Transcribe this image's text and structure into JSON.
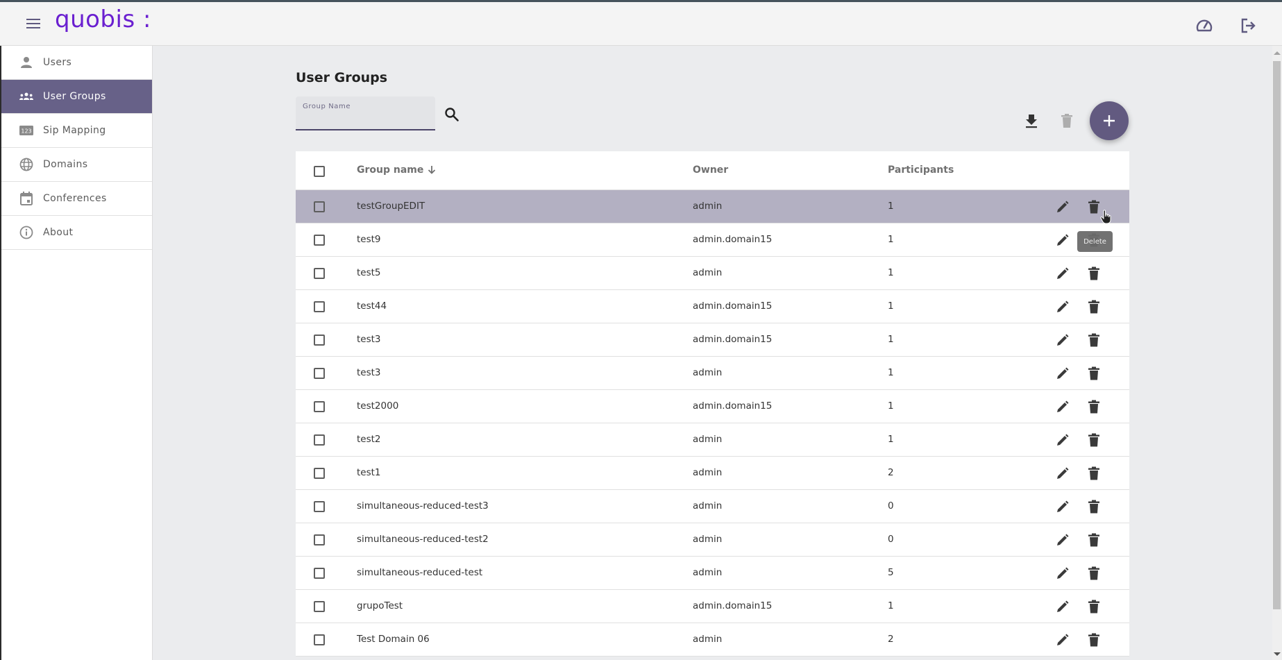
{
  "app": {
    "logo_text": "quobis :",
    "brand_color": "#6a1fd0",
    "accent_color": "#625a80",
    "header_icons": [
      "dashboard-icon",
      "logout-icon"
    ]
  },
  "sidebar": {
    "items": [
      {
        "label": "Users",
        "icon": "person-icon",
        "active": false
      },
      {
        "label": "User Groups",
        "icon": "groups-icon",
        "active": true
      },
      {
        "label": "Sip Mapping",
        "icon": "numbers-123-icon",
        "active": false
      },
      {
        "label": "Domains",
        "icon": "globe-icon",
        "active": false
      },
      {
        "label": "Conferences",
        "icon": "calendar-icon",
        "active": false
      },
      {
        "label": "About",
        "icon": "info-icon",
        "active": false
      }
    ]
  },
  "main": {
    "title": "User Groups",
    "search": {
      "label": "Group Name",
      "value": "",
      "icon": "search-icon"
    },
    "toolbar": {
      "download_icon": "download-icon",
      "delete_icon": "trash-icon",
      "add_icon": "plus-icon"
    },
    "table": {
      "columns": {
        "name": "Group name",
        "owner": "Owner",
        "participants": "Participants"
      },
      "sort": {
        "column": "name",
        "direction": "desc"
      },
      "rows": [
        {
          "name": "testGroupEDIT",
          "owner": "admin",
          "participants": "1",
          "hover": true
        },
        {
          "name": "test9",
          "owner": "admin.domain15",
          "participants": "1"
        },
        {
          "name": "test5",
          "owner": "admin",
          "participants": "1"
        },
        {
          "name": "test44",
          "owner": "admin.domain15",
          "participants": "1"
        },
        {
          "name": "test3",
          "owner": "admin.domain15",
          "participants": "1"
        },
        {
          "name": "test3",
          "owner": "admin",
          "participants": "1"
        },
        {
          "name": "test2000",
          "owner": "admin.domain15",
          "participants": "1"
        },
        {
          "name": "test2",
          "owner": "admin",
          "participants": "1"
        },
        {
          "name": "test1",
          "owner": "admin",
          "participants": "2"
        },
        {
          "name": "simultaneous-reduced-test3",
          "owner": "admin",
          "participants": "0"
        },
        {
          "name": "simultaneous-reduced-test2",
          "owner": "admin",
          "participants": "0"
        },
        {
          "name": "simultaneous-reduced-test",
          "owner": "admin",
          "participants": "5"
        },
        {
          "name": "grupoTest",
          "owner": "admin.domain15",
          "participants": "1"
        },
        {
          "name": "Test Domain 06",
          "owner": "admin",
          "participants": "2"
        }
      ]
    },
    "tooltip": "Delete"
  }
}
